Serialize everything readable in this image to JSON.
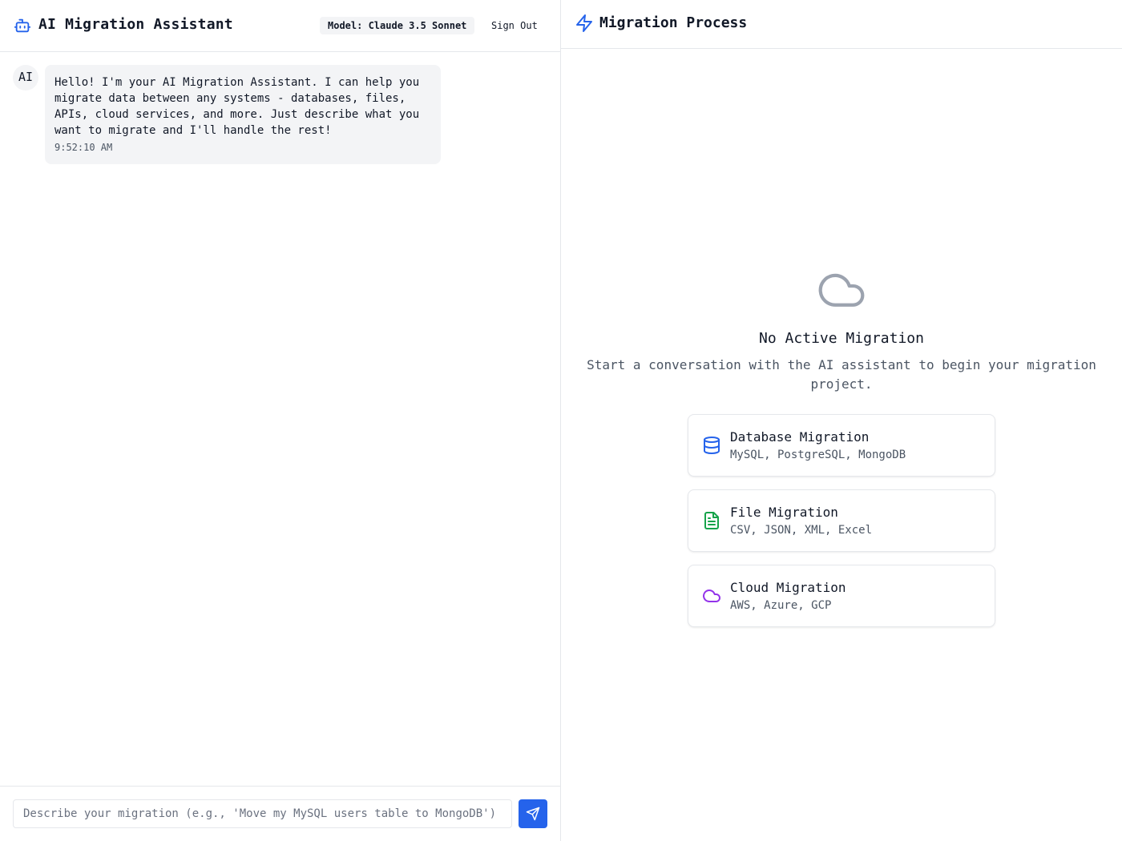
{
  "chat": {
    "title": "AI Migration Assistant",
    "model_badge": "Model: Claude 3.5 Sonnet",
    "sign_out": "Sign Out",
    "messages": [
      {
        "sender": "AI",
        "text": "Hello! I'm your AI Migration Assistant. I can help you migrate data between any systems - databases, files, APIs, cloud services, and more. Just describe what you want to migrate and I'll handle the rest!",
        "time": "9:52:10 AM"
      }
    ],
    "input": {
      "value": "",
      "placeholder": "Describe your migration (e.g., 'Move my MySQL users table to MongoDB')"
    }
  },
  "process": {
    "title": "Migration Process",
    "empty_title": "No Active Migration",
    "empty_description": "Start a conversation with the AI assistant to begin your migration project.",
    "options": [
      {
        "icon": "database-icon",
        "title": "Database Migration",
        "subtitle": "MySQL, PostgreSQL, MongoDB",
        "color": "#2563eb"
      },
      {
        "icon": "file-text-icon",
        "title": "File Migration",
        "subtitle": "CSV, JSON, XML, Excel",
        "color": "#16a34a"
      },
      {
        "icon": "cloud-icon",
        "title": "Cloud Migration",
        "subtitle": "AWS, Azure, GCP",
        "color": "#9333ea"
      }
    ]
  },
  "colors": {
    "accent": "#2563eb",
    "border": "#e5e7eb",
    "bubble": "#f3f4f6",
    "muted_text": "#4b5563"
  }
}
